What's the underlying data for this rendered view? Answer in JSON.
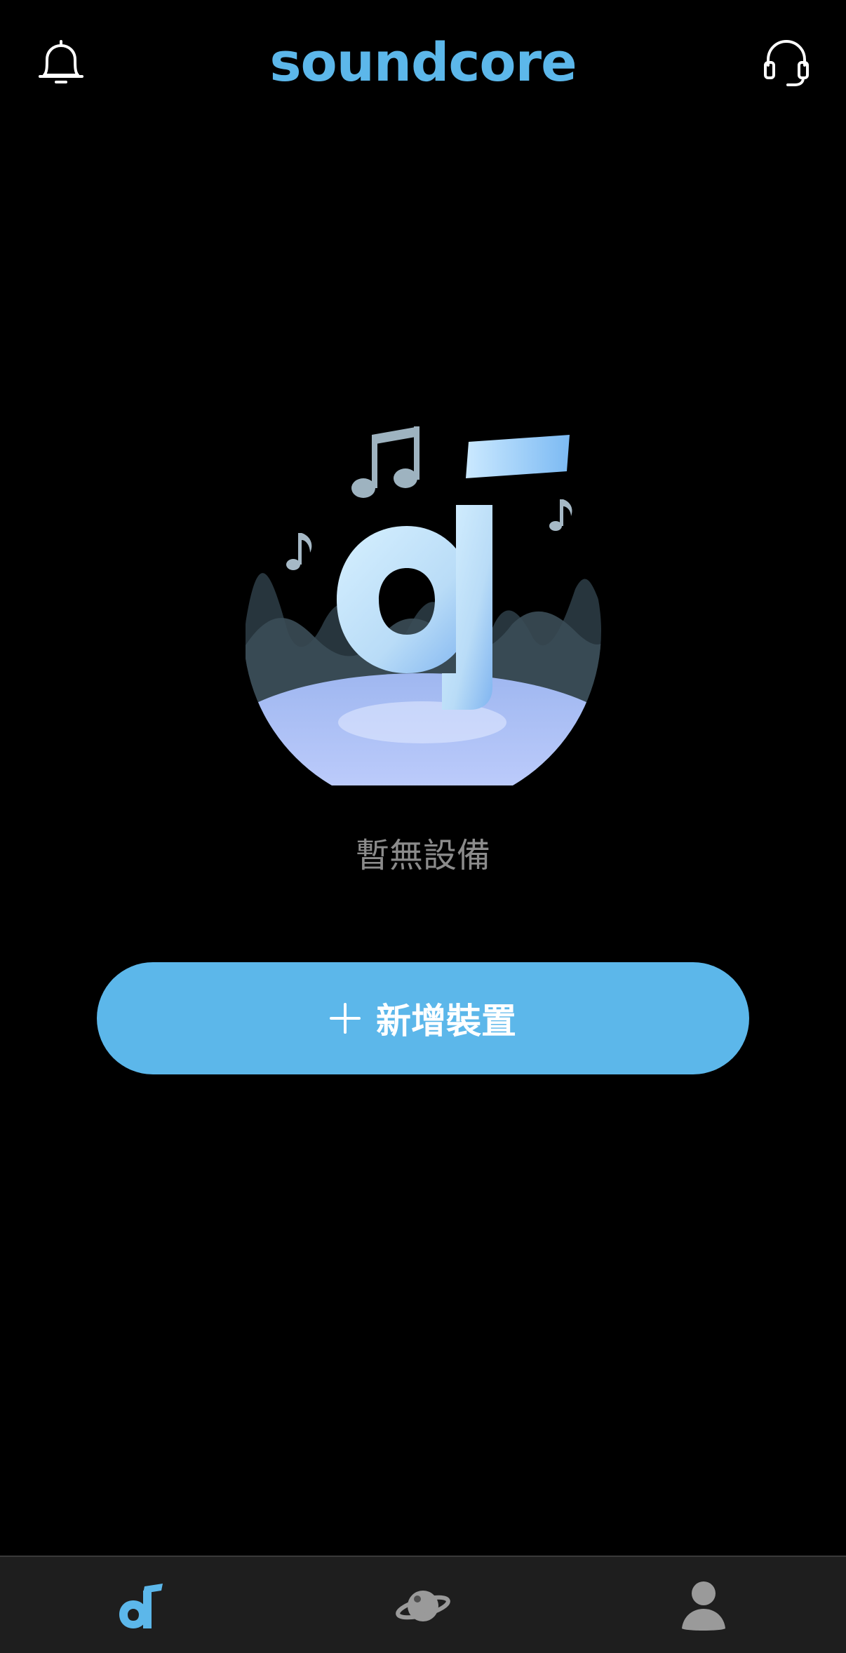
{
  "header": {
    "logo_text": "soundcore",
    "icons": {
      "left": "bell-icon",
      "right": "headset-icon"
    }
  },
  "main": {
    "empty_text": "暫無設備",
    "add_button_label": "新增裝置",
    "add_button_icon": "plus-icon"
  },
  "bottom_nav": {
    "items": [
      {
        "icon": "music-note-icon",
        "active": true
      },
      {
        "icon": "planet-icon",
        "active": false
      },
      {
        "icon": "user-icon",
        "active": false
      }
    ]
  },
  "colors": {
    "background": "#000000",
    "accent": "#5cb7ea",
    "muted_text": "#8b8b8b",
    "nav_background": "#1e1e1e",
    "nav_inactive": "#9a9a9a"
  }
}
